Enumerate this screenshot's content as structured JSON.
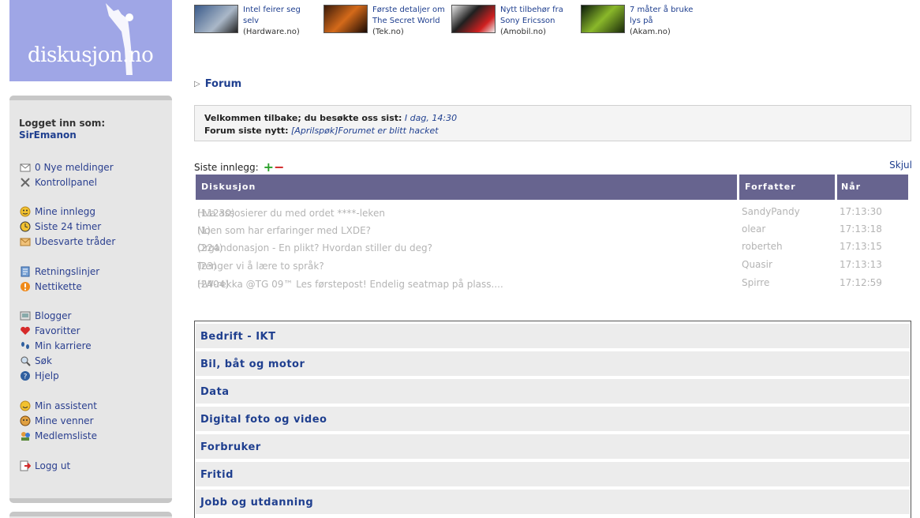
{
  "logo": {
    "text": "diskusjon.no"
  },
  "login": {
    "label": "Logget inn som:",
    "username": "SirEmanon"
  },
  "nav": [
    {
      "label": "0 Nye meldinger",
      "icon": "mail-icon"
    },
    {
      "label": "Kontrollpanel",
      "icon": "tools-icon"
    },
    {
      "label": "Mine innlegg",
      "icon": "smiley-icon"
    },
    {
      "label": "Siste 24 timer",
      "icon": "clock-icon"
    },
    {
      "label": "Ubesvarte tråder",
      "icon": "envelope-icon"
    },
    {
      "label": "Retningslinjer",
      "icon": "rules-icon"
    },
    {
      "label": "Nettikette",
      "icon": "warning-icon"
    },
    {
      "label": "Blogger",
      "icon": "blog-icon"
    },
    {
      "label": "Favoritter",
      "icon": "heart-icon"
    },
    {
      "label": "Min karriere",
      "icon": "footprints-icon"
    },
    {
      "label": "Søk",
      "icon": "magnifier-icon"
    },
    {
      "label": "Hjelp",
      "icon": "help-icon"
    },
    {
      "label": "Min assistent",
      "icon": "assistant-icon"
    },
    {
      "label": "Mine venner",
      "icon": "friends-icon"
    },
    {
      "label": "Medlemsliste",
      "icon": "members-icon"
    },
    {
      "label": "Logg ut",
      "icon": "logout-icon"
    }
  ],
  "news": [
    {
      "title": "Intel feirer seg selv",
      "source": "(Hardware.no)"
    },
    {
      "title": "Første detaljer om The Secret World",
      "source": "(Tek.no)"
    },
    {
      "title": "Nytt tilbehør fra Sony Ericsson",
      "source": "(Amobil.no)"
    },
    {
      "title": "7 måter å bruke lys på",
      "source": "(Akam.no)"
    }
  ],
  "forum": {
    "breadcrumb": "Forum",
    "welcome_label": "Velkommen tilbake; du besøkte oss sist:",
    "welcome_time": "I dag, 14:30",
    "news_label": "Forum siste nytt:",
    "news_text": "[Aprilspøk]Forumet er blitt hacket"
  },
  "latest": {
    "label": "Siste innlegg:",
    "plus": "+",
    "minus": "−",
    "hide": "Skjul",
    "columns": {
      "discussion": "Diskusjon",
      "author": "Forfatter",
      "when": "Når"
    },
    "rows": [
      {
        "title": "Hva assosierer du med ordet ****-leken",
        "count": "(11230)",
        "author": "SandyPandy",
        "time": "17:13:30"
      },
      {
        "title": "Noen som har erfaringer med LXDE?",
        "count": "(1)",
        "author": "olear",
        "time": "17:13:18"
      },
      {
        "title": "Organdonasjon - En plikt? Hvordan stiller du deg?",
        "count": "(224)",
        "author": "roberteh",
        "time": "17:13:15"
      },
      {
        "title": "Trenger vi å lære to språk?",
        "count": "(23)",
        "author": "Quasir",
        "time": "17:13:13"
      },
      {
        "title": "HW-rekka @TG 09™ Les førstepost! Endelig seatmap på plass....",
        "count": "(2404)",
        "author": "Spirre",
        "time": "17:12:59"
      }
    ]
  },
  "categories": [
    "Bedrift - IKT",
    "Bil, båt og motor",
    "Data",
    "Digital foto og video",
    "Forbruker",
    "Fritid",
    "Jobb og utdanning"
  ]
}
